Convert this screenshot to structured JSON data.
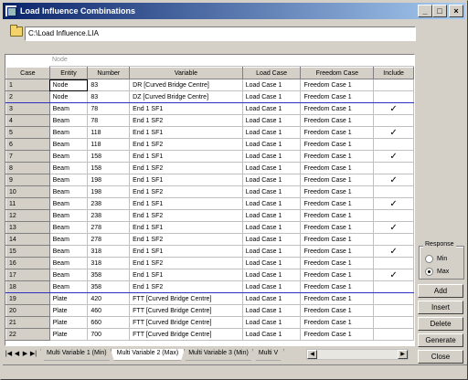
{
  "window": {
    "title": "Load Influence Combinations",
    "minimize": "_",
    "maximize": "□",
    "close": "×"
  },
  "file": {
    "path": "C:\\Load Influence.LIA"
  },
  "grid": {
    "hint": "Node",
    "columns": [
      "Case",
      "Entity",
      "Number",
      "Variable",
      "Load Case",
      "Freedom Case",
      "Include"
    ],
    "rows": [
      [
        "1",
        "Node",
        "83",
        "DR [Curved Bridge Centre]",
        "Load Case 1",
        "Freedom Case 1",
        ""
      ],
      [
        "2",
        "Node",
        "83",
        "DZ [Curved Bridge Centre]",
        "Load Case 1",
        "Freedom Case 1",
        ""
      ],
      [
        "3",
        "Beam",
        "78",
        "End 1 SF1",
        "Load Case 1",
        "Freedom Case 1",
        "✓"
      ],
      [
        "4",
        "Beam",
        "78",
        "End 1 SF2",
        "Load Case 1",
        "Freedom Case 1",
        ""
      ],
      [
        "5",
        "Beam",
        "118",
        "End 1 SF1",
        "Load Case 1",
        "Freedom Case 1",
        "✓"
      ],
      [
        "6",
        "Beam",
        "118",
        "End 1 SF2",
        "Load Case 1",
        "Freedom Case 1",
        ""
      ],
      [
        "7",
        "Beam",
        "158",
        "End 1 SF1",
        "Load Case 1",
        "Freedom Case 1",
        "✓"
      ],
      [
        "8",
        "Beam",
        "158",
        "End 1 SF2",
        "Load Case 1",
        "Freedom Case 1",
        ""
      ],
      [
        "9",
        "Beam",
        "198",
        "End 1 SF1",
        "Load Case 1",
        "Freedom Case 1",
        "✓"
      ],
      [
        "10",
        "Beam",
        "198",
        "End 1 SF2",
        "Load Case 1",
        "Freedom Case 1",
        ""
      ],
      [
        "11",
        "Beam",
        "238",
        "End 1 SF1",
        "Load Case 1",
        "Freedom Case 1",
        "✓"
      ],
      [
        "12",
        "Beam",
        "238",
        "End 1 SF2",
        "Load Case 1",
        "Freedom Case 1",
        ""
      ],
      [
        "13",
        "Beam",
        "278",
        "End 1 SF1",
        "Load Case 1",
        "Freedom Case 1",
        "✓"
      ],
      [
        "14",
        "Beam",
        "278",
        "End 1 SF2",
        "Load Case 1",
        "Freedom Case 1",
        ""
      ],
      [
        "15",
        "Beam",
        "318",
        "End 1 SF1",
        "Load Case 1",
        "Freedom Case 1",
        "✓"
      ],
      [
        "16",
        "Beam",
        "318",
        "End 1 SF2",
        "Load Case 1",
        "Freedom Case 1",
        ""
      ],
      [
        "17",
        "Beam",
        "358",
        "End 1 SF1",
        "Load Case 1",
        "Freedom Case 1",
        "✓"
      ],
      [
        "18",
        "Beam",
        "358",
        "End 1 SF2",
        "Load Case 1",
        "Freedom Case 1",
        ""
      ],
      [
        "19",
        "Plate",
        "420",
        "FTT [Curved Bridge Centre]",
        "Load Case 1",
        "Freedom Case 1",
        ""
      ],
      [
        "20",
        "Plate",
        "460",
        "FTT [Curved Bridge Centre]",
        "Load Case 1",
        "Freedom Case 1",
        ""
      ],
      [
        "21",
        "Plate",
        "660",
        "FTT [Curved Bridge Centre]",
        "Load Case 1",
        "Freedom Case 1",
        ""
      ],
      [
        "22",
        "Plate",
        "700",
        "FTT [Curved Bridge Centre]",
        "Load Case 1",
        "Freedom Case 1",
        ""
      ]
    ]
  },
  "tabs": {
    "nav": [
      "|◀",
      "◀",
      "▶",
      "▶|"
    ],
    "items": [
      "Multi Variable 1 (Min)",
      "Multi Variable 2 (Max)",
      "Multi Variable 3 (Min)",
      "Multi V"
    ],
    "active_index": 1
  },
  "response": {
    "label": "Response",
    "options": [
      "Min",
      "Max"
    ],
    "selected": "Max"
  },
  "buttons": {
    "add": "Add",
    "insert": "Insert",
    "delete": "Delete",
    "generate": "Generate",
    "close": "Close"
  }
}
